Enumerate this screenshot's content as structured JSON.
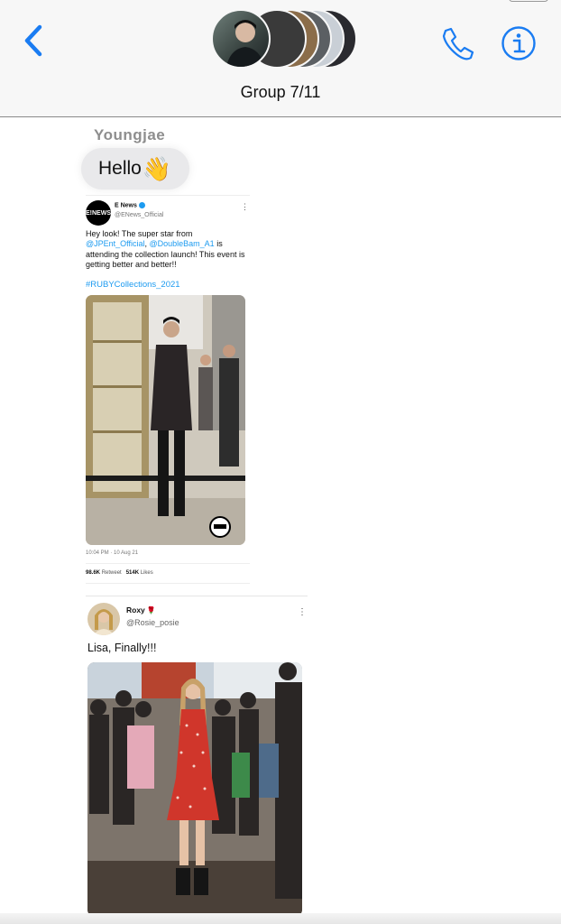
{
  "header": {
    "title": "Group 7/11",
    "back_icon": "chevron-left-icon",
    "call_icon": "phone-icon",
    "info_icon": "info-icon",
    "accent_color": "#1a7cf2"
  },
  "message": {
    "sender": "Youngjae",
    "text": "Hello",
    "emoji": "👋"
  },
  "tweet1": {
    "logo_text": "E!NEWS",
    "name": "E News",
    "handle": "@ENews_Official",
    "text_lines": {
      "before": "Hey look! The super star from ",
      "mention1": "@JPEnt_Official",
      "sep": ", ",
      "mention2": "@DoubleBam_A1",
      "after": " is attending the collection launch! This event is getting better and better!!"
    },
    "hashtag": "#RUBYCollections_2021",
    "timestamp": "10:04 PM · 10 Aug 21",
    "retweets": "98.6K",
    "retweets_label": "Retweet",
    "likes": "514K",
    "likes_label": "Likes"
  },
  "tweet2": {
    "name": "Roxy",
    "rose": "🌹",
    "handle": "@Rosie_posie",
    "text": "Lisa, Finally!!!"
  }
}
